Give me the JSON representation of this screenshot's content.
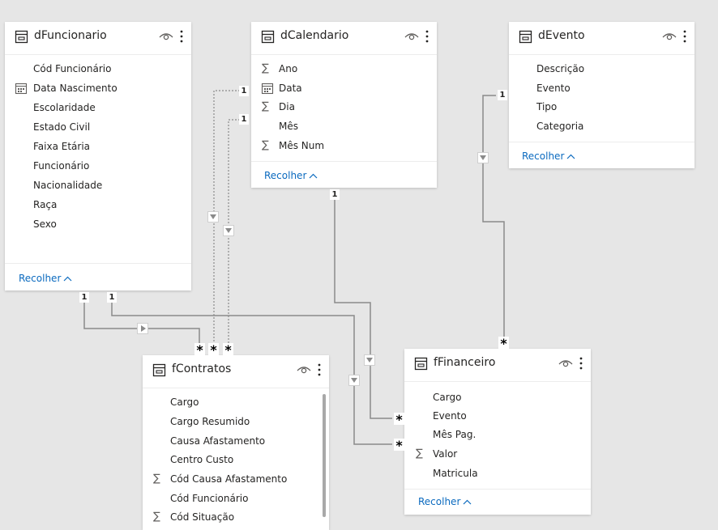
{
  "tables": {
    "dFuncionario": {
      "title": "dFuncionario",
      "fields": [
        {
          "label": "Cód Funcionário",
          "icon": ""
        },
        {
          "label": "Data Nascimento",
          "icon": "calendar-icon"
        },
        {
          "label": "Escolaridade",
          "icon": ""
        },
        {
          "label": "Estado Civil",
          "icon": ""
        },
        {
          "label": "Faixa Etária",
          "icon": ""
        },
        {
          "label": "Funcionário",
          "icon": ""
        },
        {
          "label": "Nacionalidade",
          "icon": ""
        },
        {
          "label": "Raça",
          "icon": ""
        },
        {
          "label": "Sexo",
          "icon": ""
        }
      ],
      "collapse_label": "Recolher"
    },
    "dCalendario": {
      "title": "dCalendario",
      "fields": [
        {
          "label": "Ano",
          "icon": "sigma-icon"
        },
        {
          "label": "Data",
          "icon": "calendar-icon"
        },
        {
          "label": "Dia",
          "icon": "sigma-icon"
        },
        {
          "label": "Mês",
          "icon": ""
        },
        {
          "label": "Mês Num",
          "icon": "sigma-icon"
        }
      ],
      "collapse_label": "Recolher"
    },
    "dEvento": {
      "title": "dEvento",
      "fields": [
        {
          "label": "Descrição",
          "icon": ""
        },
        {
          "label": "Evento",
          "icon": ""
        },
        {
          "label": "Tipo",
          "icon": ""
        },
        {
          "label": "Categoria",
          "icon": ""
        }
      ],
      "collapse_label": "Recolher"
    },
    "fContratos": {
      "title": "fContratos",
      "fields": [
        {
          "label": "Cargo",
          "icon": ""
        },
        {
          "label": "Cargo Resumido",
          "icon": ""
        },
        {
          "label": "Causa Afastamento",
          "icon": ""
        },
        {
          "label": "Centro Custo",
          "icon": ""
        },
        {
          "label": "Cód Causa Afastamento",
          "icon": "sigma-icon"
        },
        {
          "label": "Cód Funcionário",
          "icon": ""
        },
        {
          "label": "Cód Situação",
          "icon": "sigma-icon"
        }
      ]
    },
    "fFinanceiro": {
      "title": "fFinanceiro",
      "fields": [
        {
          "label": "Cargo",
          "icon": ""
        },
        {
          "label": "Evento",
          "icon": ""
        },
        {
          "label": "Mês Pag.",
          "icon": ""
        },
        {
          "label": "Valor",
          "icon": "sigma-icon"
        },
        {
          "label": "Matricula",
          "icon": ""
        }
      ],
      "collapse_label": "Recolher"
    }
  },
  "cardinality": {
    "one": "1",
    "many": "*"
  },
  "colors": {
    "canvas": "#e6e6e6",
    "card": "#ffffff",
    "link": "#0b6abf",
    "relationship_line": "#8a8a8a"
  }
}
